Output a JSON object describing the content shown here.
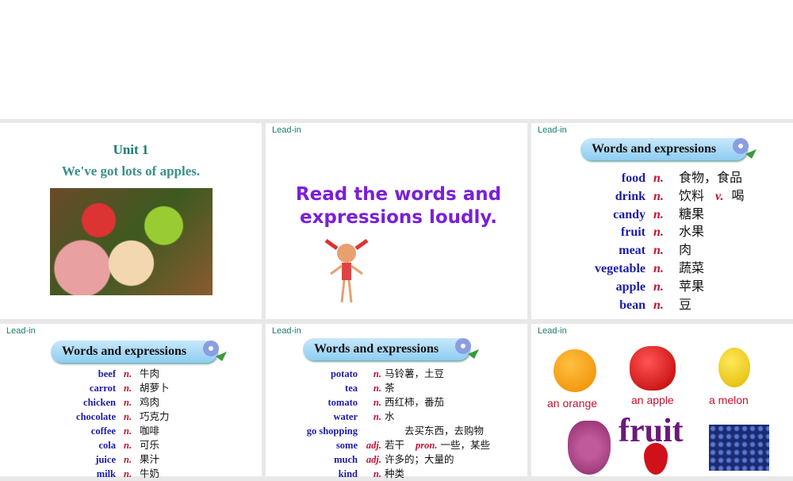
{
  "slide1": {
    "unit": "Unit 1",
    "title": "We've got lots of apples."
  },
  "slide2": {
    "label": "Lead-in",
    "text": "Read the words and expressions loudly."
  },
  "slide3": {
    "label": "Lead-in",
    "banner": "Words and expressions",
    "rows": [
      {
        "w": "food",
        "p": "n.",
        "cn": "食物，食品"
      },
      {
        "w": "drink",
        "p": "n.",
        "cn": "饮料",
        "p2": "v.",
        "cn2": "喝"
      },
      {
        "w": "candy",
        "p": "n.",
        "cn": "糖果"
      },
      {
        "w": "fruit",
        "p": "n.",
        "cn": "水果"
      },
      {
        "w": "meat",
        "p": "n.",
        "cn": "肉"
      },
      {
        "w": "vegetable",
        "p": "n.",
        "cn": "蔬菜"
      },
      {
        "w": "apple",
        "p": "n.",
        "cn": "苹果"
      },
      {
        "w": "bean",
        "p": "n.",
        "cn": "豆"
      }
    ]
  },
  "slide4": {
    "label": "Lead-in",
    "banner": "Words and expressions",
    "rows": [
      {
        "w": "beef",
        "p": "n.",
        "cn": "牛肉"
      },
      {
        "w": "carrot",
        "p": "n.",
        "cn": "胡萝卜"
      },
      {
        "w": "chicken",
        "p": "n.",
        "cn": "鸡肉"
      },
      {
        "w": "chocolate",
        "p": "n.",
        "cn": "巧克力"
      },
      {
        "w": "coffee",
        "p": "n.",
        "cn": "咖啡"
      },
      {
        "w": "cola",
        "p": "n.",
        "cn": "可乐"
      },
      {
        "w": "juice",
        "p": "n.",
        "cn": "果汁"
      },
      {
        "w": "milk",
        "p": "n.",
        "cn": "牛奶"
      }
    ]
  },
  "slide5": {
    "label": "Lead-in",
    "banner": "Words and expressions",
    "rows": [
      {
        "w": "potato",
        "p": "n.",
        "cn": "马铃薯，土豆"
      },
      {
        "w": "tea",
        "p": "n.",
        "cn": "茶"
      },
      {
        "w": "tomato",
        "p": "n.",
        "cn": "西红柿，番茄"
      },
      {
        "w": "water",
        "p": "n.",
        "cn": "水"
      },
      {
        "w": "go shopping",
        "p": "",
        "cn": "　　去买东西，去购物"
      },
      {
        "w": "some",
        "p": "adj.",
        "cn": "若干",
        "p2": "pron.",
        "cn2": "一些，某些"
      },
      {
        "w": "much",
        "p": "adj.",
        "cn": "许多的；大量的"
      },
      {
        "w": "kind",
        "p": "n.",
        "cn": "种类"
      }
    ]
  },
  "slide6": {
    "label": "Lead-in",
    "orange": "an orange",
    "apple": "an apple",
    "melon": "a melon",
    "fruit": "fruit"
  },
  "colors": {
    "word": "#1b1ba8",
    "pos": "#c8102e",
    "purple": "#7a1fd8"
  }
}
